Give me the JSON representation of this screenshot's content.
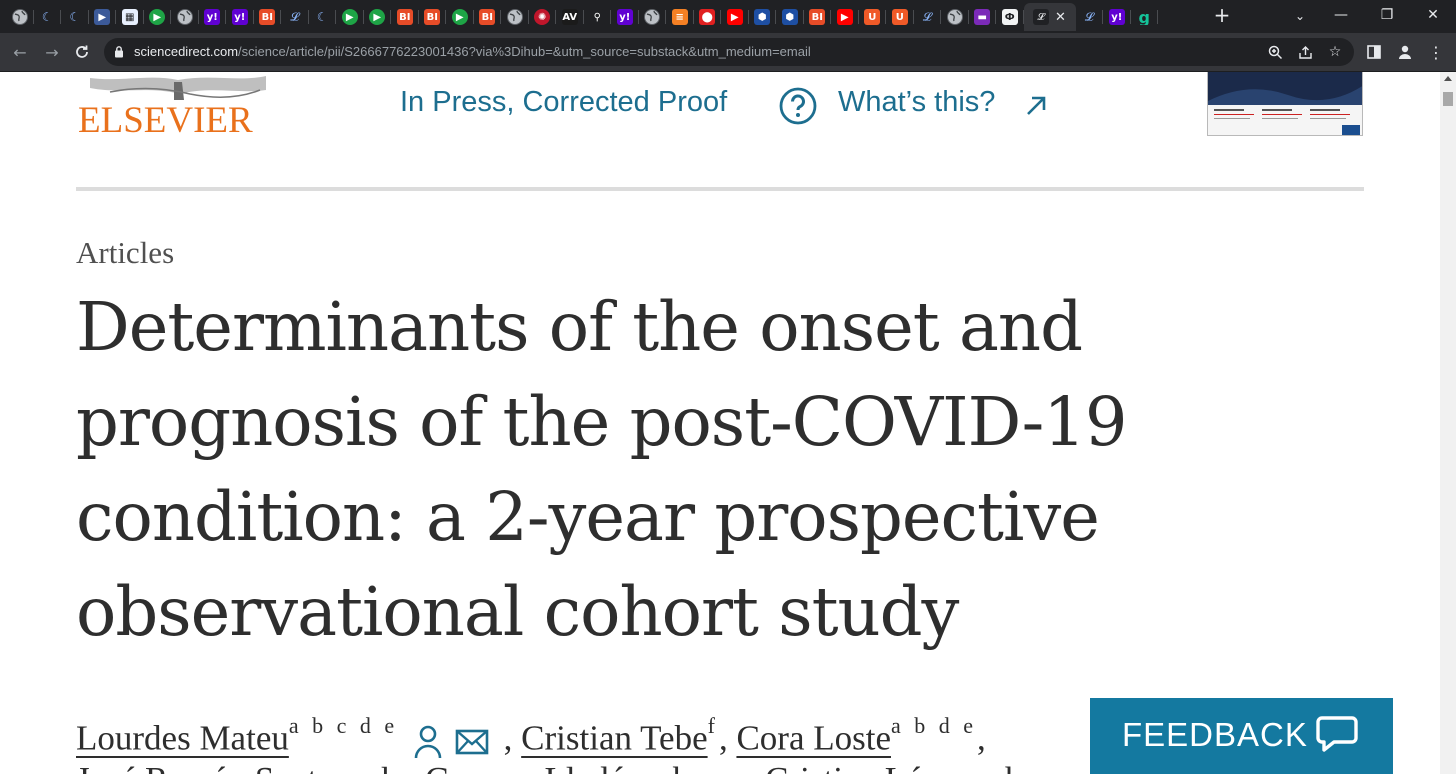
{
  "browser": {
    "tabs": [
      {
        "icon": "globe-icon",
        "color": "#5f6368",
        "glyph": "",
        "circle": true
      },
      {
        "icon": "crescent-logo-icon",
        "color": "#202124",
        "glyph": "☾",
        "circle": false
      },
      {
        "icon": "crescent-logo-icon",
        "color": "#202124",
        "glyph": "☾",
        "circle": false
      },
      {
        "icon": "play-forward-icon",
        "color": "#3c5a99",
        "glyph": "▶",
        "circle": false
      },
      {
        "icon": "image-doc-icon",
        "color": "#e8f0fe",
        "glyph": "▦",
        "circle": false
      },
      {
        "icon": "green-play-icon",
        "color": "#1ea446",
        "glyph": "▶",
        "circle": true
      },
      {
        "icon": "globe-icon",
        "color": "#5f6368",
        "glyph": "",
        "circle": true
      },
      {
        "icon": "yahoo-icon",
        "color": "#6001d2",
        "glyph": "y!",
        "circle": false
      },
      {
        "icon": "yahoo-icon",
        "color": "#6001d2",
        "glyph": "y!",
        "circle": false
      },
      {
        "icon": "business-insider-icon",
        "color": "#e74c28",
        "glyph": "BI",
        "circle": false
      },
      {
        "icon": "serif-logo-icon",
        "color": "#202124",
        "glyph": "𝓛",
        "circle": false
      },
      {
        "icon": "crescent-logo-icon",
        "color": "#202124",
        "glyph": "☾",
        "circle": false
      },
      {
        "icon": "green-play-icon",
        "color": "#1ea446",
        "glyph": "▶",
        "circle": true
      },
      {
        "icon": "green-play-icon",
        "color": "#1ea446",
        "glyph": "▶",
        "circle": true
      },
      {
        "icon": "business-insider-icon",
        "color": "#e74c28",
        "glyph": "BI",
        "circle": false
      },
      {
        "icon": "business-insider-icon",
        "color": "#e74c28",
        "glyph": "BI",
        "circle": false
      },
      {
        "icon": "green-play-icon",
        "color": "#1ea446",
        "glyph": "▶",
        "circle": true
      },
      {
        "icon": "business-insider-icon",
        "color": "#e74c28",
        "glyph": "BI",
        "circle": false
      },
      {
        "icon": "globe-icon",
        "color": "#5f6368",
        "glyph": "",
        "circle": true
      },
      {
        "icon": "starburst-icon",
        "color": "#c0162b",
        "glyph": "✺",
        "circle": true
      },
      {
        "icon": "news-logo-icon",
        "color": "#1b1b1b",
        "glyph": "AV",
        "circle": false
      },
      {
        "icon": "search-icon",
        "color": "#202124",
        "glyph": "⚲",
        "circle": false
      },
      {
        "icon": "yahoo-icon",
        "color": "#6001d2",
        "glyph": "y!",
        "circle": false
      },
      {
        "icon": "globe-icon",
        "color": "#5f6368",
        "glyph": "",
        "circle": true
      },
      {
        "icon": "stack-icon",
        "color": "#f48024",
        "glyph": "≡",
        "circle": false
      },
      {
        "icon": "red-pin-icon",
        "color": "#e02020",
        "glyph": "⬤",
        "circle": false
      },
      {
        "icon": "youtube-icon",
        "color": "#ff0000",
        "glyph": "▶",
        "circle": false
      },
      {
        "icon": "hex-logo-icon",
        "color": "#1e4fa3",
        "glyph": "⬢",
        "circle": false
      },
      {
        "icon": "hex-logo-icon",
        "color": "#1e4fa3",
        "glyph": "⬢",
        "circle": false
      },
      {
        "icon": "business-insider-icon",
        "color": "#e74c28",
        "glyph": "BI",
        "circle": false
      },
      {
        "icon": "youtube-icon",
        "color": "#ff0000",
        "glyph": "▶",
        "circle": false
      },
      {
        "icon": "shield-logo-icon",
        "color": "#f05a28",
        "glyph": "U",
        "circle": false
      },
      {
        "icon": "shield-logo-icon",
        "color": "#f05a28",
        "glyph": "U",
        "circle": false
      },
      {
        "icon": "serif-logo-icon",
        "color": "#202124",
        "glyph": "𝓛",
        "circle": false
      },
      {
        "icon": "globe-icon",
        "color": "#5f6368",
        "glyph": "",
        "circle": true
      },
      {
        "icon": "purple-bar-icon",
        "color": "#7b2ab8",
        "glyph": "▬",
        "circle": false
      },
      {
        "icon": "dark-box-logo-icon",
        "color": "#f1f3f4",
        "glyph": "Ф",
        "circle": false
      }
    ],
    "active_tab": {
      "icon": "serif-logo-icon",
      "glyph": "𝓛",
      "color": "#202124"
    },
    "tabs_after": [
      {
        "icon": "serif-logo-icon",
        "color": "#202124",
        "glyph": "𝓛",
        "circle": false
      },
      {
        "icon": "yahoo-icon",
        "color": "#6001d2",
        "glyph": "y!",
        "circle": false
      },
      {
        "icon": "grammarly-icon",
        "color": "#15c39a",
        "glyph": "g",
        "circle": false
      }
    ],
    "url_host": "sciencedirect.com",
    "url_path": "/science/article/pii/S2666776223001436?via%3Dihub=&utm_source=substack&utm_medium=email"
  },
  "header": {
    "publisher": "ELSEVIER",
    "status": "In Press, Corrected Proof",
    "help_link": "What’s this?"
  },
  "article": {
    "section": "Articles",
    "title": "Determinants of the onset and prognosis of the post-COVID-19 condition: a 2-year prospective observational cohort study",
    "authors": [
      {
        "name": "Lourdes Mateu",
        "aff": "a b c d e"
      },
      {
        "name": "Cristian Tebe",
        "aff": "f"
      },
      {
        "name": "Cora Loste",
        "aff": "a b d e"
      }
    ],
    "author_sep1": " , ",
    "author_sep2": ", ",
    "author_sep3": ",",
    "line2": "José Ramón Santos  a h ,  Gemma Lladós  a b c e ,  Cristian López  a b"
  },
  "feedback": {
    "label": "FEEDBACK"
  },
  "colors": {
    "link": "#1d6e8f",
    "publisher": "#e9711c",
    "feedback_bg": "#1479a0"
  }
}
